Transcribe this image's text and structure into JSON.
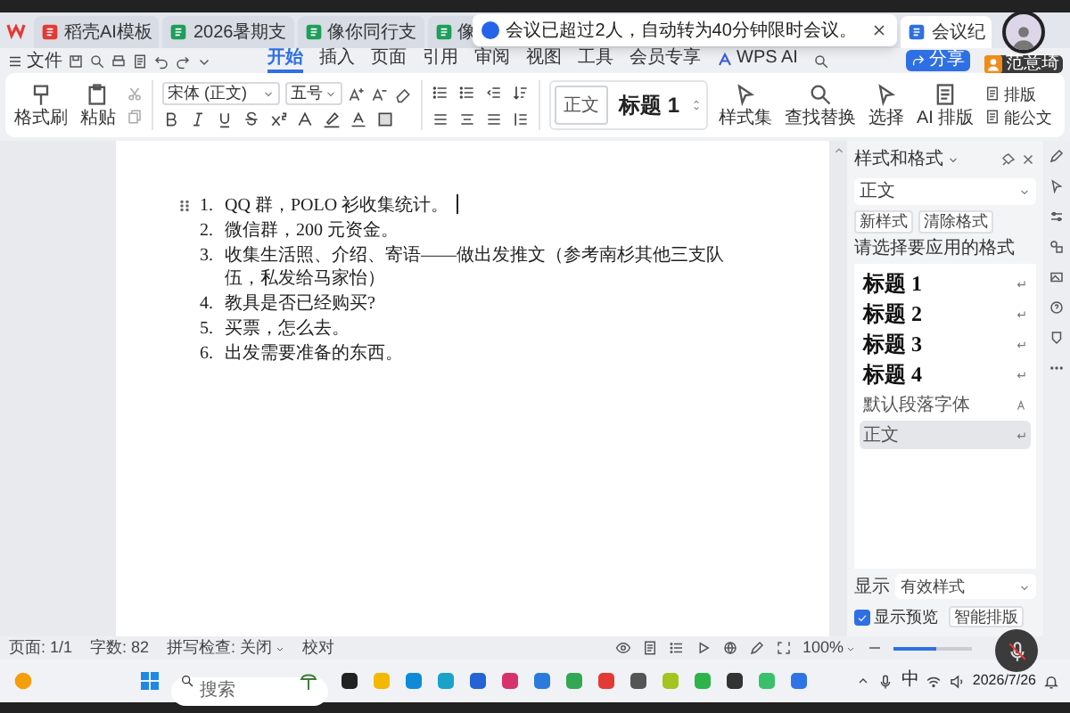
{
  "tabs": [
    {
      "label": "稻壳AI模板",
      "kind": "pdf",
      "selected": false
    },
    {
      "label": "2026暑期支",
      "kind": "sheet",
      "selected": false
    },
    {
      "label": "像你同行支",
      "kind": "sheet",
      "selected": false
    },
    {
      "label": "像",
      "kind": "sheet",
      "selected": false
    },
    {
      "label": "会议纪",
      "kind": "doc",
      "selected": true
    }
  ],
  "notification": {
    "text": "会议已超过2人，自动转为40分钟限时会议。"
  },
  "menu": {
    "file": "文件",
    "tabs": [
      {
        "label": "开始",
        "selected": true
      },
      {
        "label": "插入",
        "selected": false
      },
      {
        "label": "页面",
        "selected": false
      },
      {
        "label": "引用",
        "selected": false
      },
      {
        "label": "审阅",
        "selected": false
      },
      {
        "label": "视图",
        "selected": false
      },
      {
        "label": "工具",
        "selected": false
      },
      {
        "label": "会员专享",
        "selected": false
      },
      {
        "label": "WPS AI",
        "selected": false
      }
    ],
    "share": "分享"
  },
  "ribbon": {
    "format_painter": "格式刷",
    "paste": "粘贴",
    "font": "宋体 (正文)",
    "size": "五号",
    "gallery": [
      {
        "label": "正文",
        "kind": "body"
      },
      {
        "label": "标题 1",
        "kind": "heading"
      }
    ],
    "buttons": [
      "样式集",
      "查找替换",
      "选择",
      "AI 排版"
    ],
    "small": [
      "排版",
      "能公文"
    ]
  },
  "document": {
    "items": [
      {
        "number": "1.",
        "text": "QQ 群，POLO 衫收集统计。"
      },
      {
        "number": "2.",
        "text": "微信群，200 元资金。"
      },
      {
        "number": "3.",
        "text": "收集生活照、介绍、寄语——做出发推文（参考南杉其他三支队伍，私发给马家怡）"
      },
      {
        "number": "4.",
        "text": "教具是否已经购买?"
      },
      {
        "number": "5.",
        "text": "买票，怎么去。"
      },
      {
        "number": "6.",
        "text": "出发需要准备的东西。"
      }
    ]
  },
  "styles_pane": {
    "title": "样式和格式",
    "current": "正文",
    "new_style": "新样式",
    "clear_format": "清除格式",
    "prompt": "请选择要应用的格式",
    "styles": [
      {
        "label": "标题 1",
        "kind": "heading",
        "selected": false
      },
      {
        "label": "标题 2",
        "kind": "heading",
        "selected": false
      },
      {
        "label": "标题 3",
        "kind": "heading",
        "selected": false
      },
      {
        "label": "标题 4",
        "kind": "heading",
        "selected": false
      },
      {
        "label": "默认段落字体",
        "kind": "font",
        "selected": false
      },
      {
        "label": "正文",
        "kind": "body",
        "selected": true
      }
    ],
    "show_label": "显示",
    "show_value": "有效样式",
    "preview": {
      "label": "显示预览",
      "checked": true
    },
    "smart": "智能排版"
  },
  "status_bar": {
    "page": "页面: 1/1",
    "words": "字数: 82",
    "spell": "拼写检查: 关闭",
    "proof": "校对",
    "zoom": "100%",
    "zoom_slider": {
      "level": 0.55
    }
  },
  "taskbar": {
    "search_placeholder": "搜索",
    "input_method": "中",
    "date": "2026/7/26"
  },
  "user": {
    "name": "范意琦"
  }
}
